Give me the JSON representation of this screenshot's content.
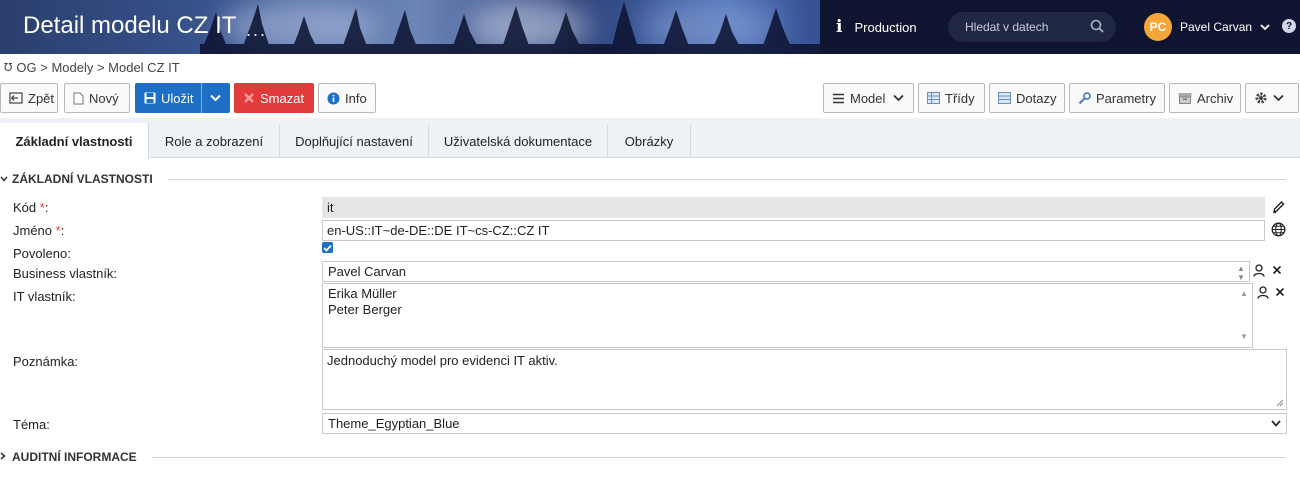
{
  "header": {
    "title": "Detail modelu CZ IT",
    "more": "...",
    "environment": "Production",
    "search_placeholder": "Hledat v datech",
    "user_initials": "PC",
    "user_name": "Pavel Carvan",
    "help": "?"
  },
  "breadcrumb": "OG > Modely > Model CZ IT",
  "toolbar": {
    "back": "Zpět",
    "new": "Nový",
    "save": "Uložit",
    "delete": "Smazat",
    "info": "Info",
    "model": "Model",
    "classes": "Třídy",
    "queries": "Dotazy",
    "parameters": "Parametry",
    "archive": "Archiv"
  },
  "tabs": [
    {
      "label": "Základní vlastnosti",
      "active": true
    },
    {
      "label": "Role a zobrazení"
    },
    {
      "label": "Doplňující nastavení"
    },
    {
      "label": "Uživatelská dokumentace"
    },
    {
      "label": "Obrázky"
    }
  ],
  "sections": {
    "basic": "ZÁKLADNÍ VLASTNOSTI",
    "audit": "AUDITNÍ INFORMACE"
  },
  "form": {
    "code_label": "Kód",
    "code_value": "it",
    "name_label": "Jméno",
    "name_value": "en-US::IT~de-DE::DE IT~cs-CZ::CZ IT",
    "enabled_label": "Povoleno:",
    "business_owner_label": "Business vlastník:",
    "business_owner_value": "Pavel Carvan",
    "it_owner_label": "IT vlastník:",
    "it_owners": [
      "Erika Müller",
      "Peter Berger"
    ],
    "note_label": "Poznámka:",
    "note_value": "Jednoduchý model pro evidenci IT aktiv.",
    "theme_label": "Téma:",
    "theme_value": "Theme_Egyptian_Blue",
    "required_mark": "*",
    "colon": ":"
  },
  "colors": {
    "primary": "#1e6fc6",
    "danger": "#e23b3b",
    "avatar": "#f5a63a"
  }
}
